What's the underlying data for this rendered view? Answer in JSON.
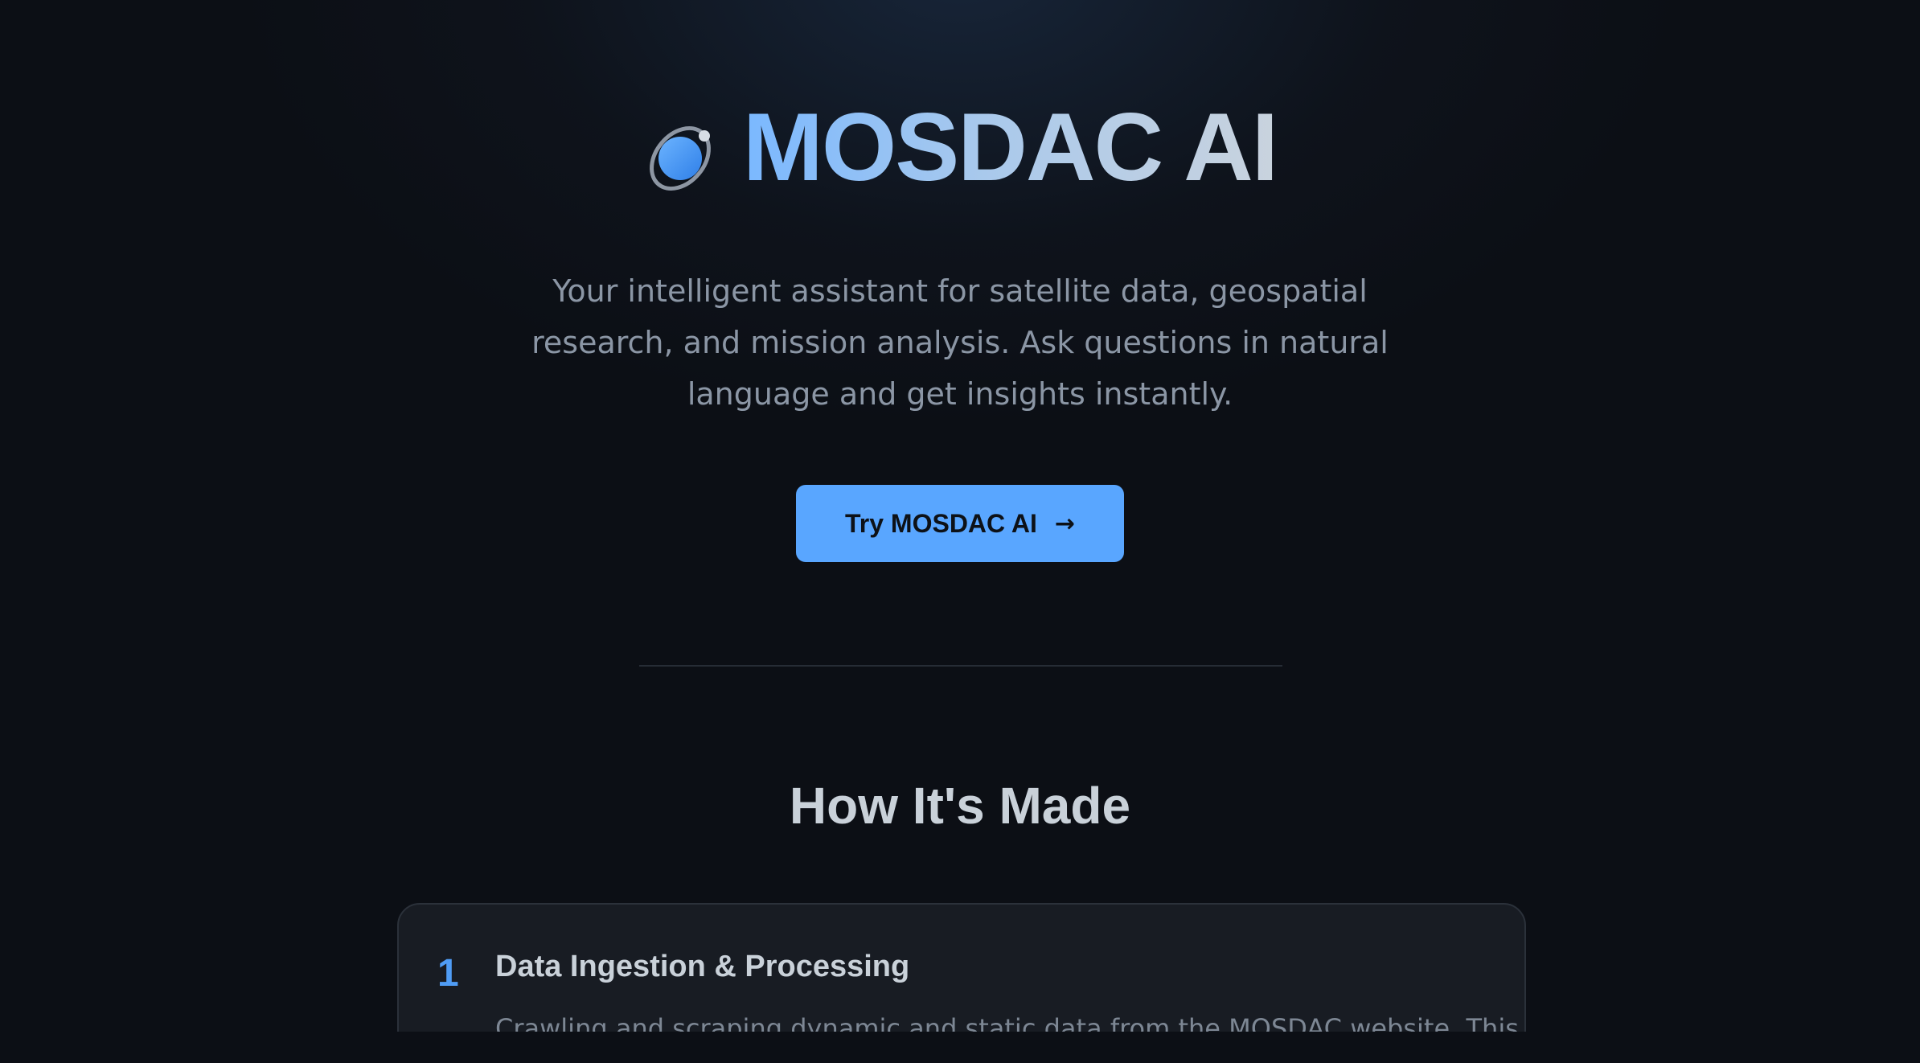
{
  "hero": {
    "title": "MOSDAC AI",
    "logo_icon": "satellite-orbit-icon",
    "subtitle": "Your intelligent assistant for satellite data, geospatial research, and mission analysis. Ask questions in natural language and get insights instantly.",
    "cta_label": "Try MOSDAC AI",
    "cta_icon": "arrow-right-icon"
  },
  "section": {
    "title": "How It's Made"
  },
  "steps": [
    {
      "number": "1",
      "title": "Data Ingestion & Processing",
      "description": "Crawling and scraping dynamic and static data from the MOSDAC website. This"
    }
  ],
  "colors": {
    "background": "#0c0f15",
    "accent": "#59a6ff",
    "card": "#181c23",
    "muted_text": "#8b96a5"
  }
}
